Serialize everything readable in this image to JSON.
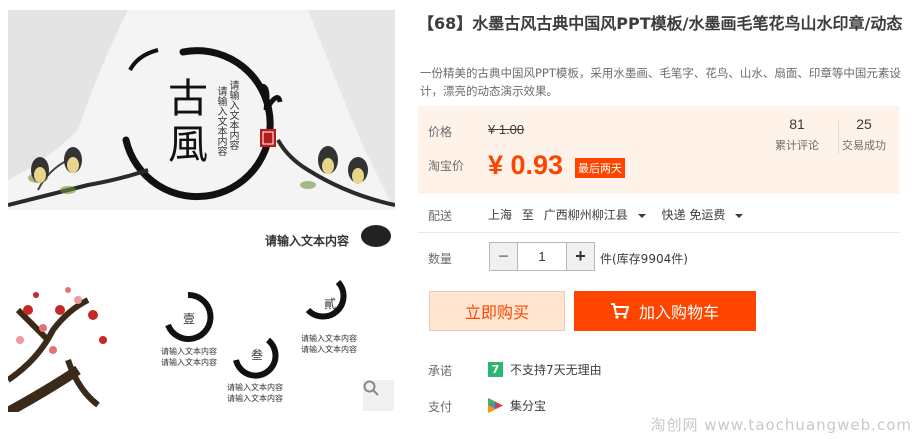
{
  "product": {
    "title": "【68】水墨古风古典中国风PPT模板/水墨画毛笔花鸟山水印章/动态",
    "description": "一份精美的古典中国风PPT模板，采用水墨画、毛笔字、花鸟、山水、扇面、印章等中国元素设计，漂亮的动态演示效果。"
  },
  "gallery": {
    "big_char_1": "古",
    "big_char_2": "風",
    "vertical_text_1": "请输入文本内容",
    "vertical_text_2": "请输入文本内容",
    "subtitle": "请输入文本内容",
    "circle_1_char": "壹",
    "circle_2_char": "貳",
    "circle_3_char": "叁",
    "block_text_1": "请输入文本内容\n请输入文本内容",
    "block_text_2": "请输入文本内容\n请输入文本内容",
    "block_text_3": "请输入文本内容\n请输入文本内容"
  },
  "price": {
    "label": "价格",
    "original": "¥ 1.00",
    "promo_label": "淘宝价",
    "promo_price": "¥ 0.93",
    "badge": "最后两天"
  },
  "stats": [
    {
      "value": "81",
      "label": "累计评论"
    },
    {
      "value": "25",
      "label": "交易成功"
    }
  ],
  "shipping": {
    "label": "配送",
    "from": "上海",
    "to_word": "至",
    "destination": "广西柳州柳江县",
    "method": "快递 免运费"
  },
  "quantity": {
    "label": "数量",
    "value": "1",
    "minus": "−",
    "plus": "+",
    "stock": "件(库存9904件)"
  },
  "actions": {
    "buy_now": "立即购买",
    "add_to_cart": "加入购物车"
  },
  "promise": {
    "label": "承诺",
    "icon_text": "7",
    "text": "不支持7天无理由"
  },
  "payment": {
    "label": "支付",
    "text": "集分宝"
  },
  "watermark": "淘创网 www.taochuangweb.com",
  "colors": {
    "accent": "#ff4400",
    "price_panel_bg": "#fff2e8",
    "buy_now_bg": "#ffe4d0"
  }
}
